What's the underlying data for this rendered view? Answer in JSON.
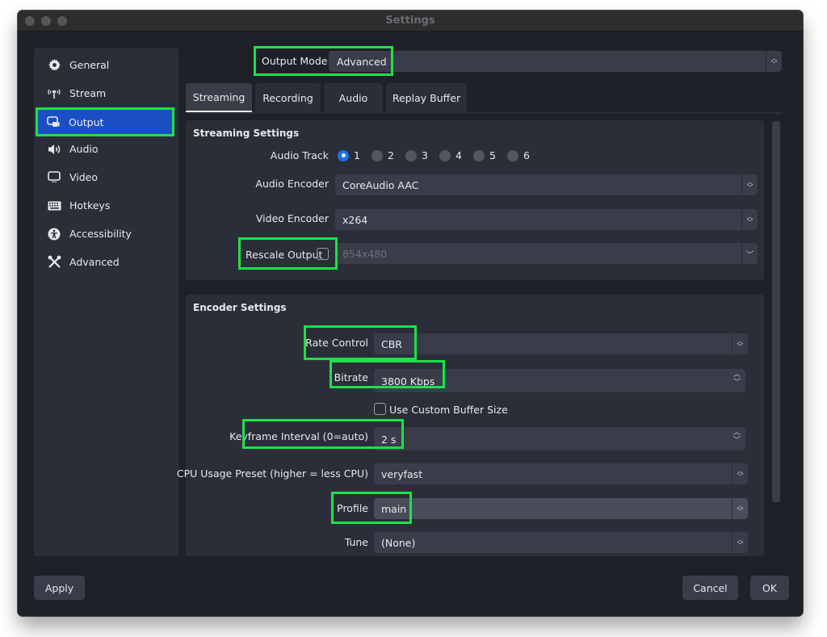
{
  "window": {
    "title": "Settings"
  },
  "sidebar": {
    "items": [
      {
        "label": "General",
        "icon": "gear-icon"
      },
      {
        "label": "Stream",
        "icon": "antenna-icon"
      },
      {
        "label": "Output",
        "icon": "output-icon",
        "active": true
      },
      {
        "label": "Audio",
        "icon": "speaker-icon"
      },
      {
        "label": "Video",
        "icon": "monitor-icon"
      },
      {
        "label": "Hotkeys",
        "icon": "keyboard-icon"
      },
      {
        "label": "Accessibility",
        "icon": "accessibility-icon"
      },
      {
        "label": "Advanced",
        "icon": "tools-icon"
      }
    ]
  },
  "output_mode": {
    "label": "Output Mode",
    "value": "Advanced"
  },
  "tabs": [
    {
      "label": "Streaming",
      "active": true
    },
    {
      "label": "Recording"
    },
    {
      "label": "Audio"
    },
    {
      "label": "Replay Buffer"
    }
  ],
  "streaming_settings": {
    "title": "Streaming Settings",
    "audio_track": {
      "label": "Audio Track",
      "options": [
        "1",
        "2",
        "3",
        "4",
        "5",
        "6"
      ],
      "selected": "1"
    },
    "audio_encoder": {
      "label": "Audio Encoder",
      "value": "CoreAudio AAC"
    },
    "video_encoder": {
      "label": "Video Encoder",
      "value": "x264"
    },
    "rescale_output": {
      "label": "Rescale Output",
      "checked": false,
      "value": "854x480"
    }
  },
  "encoder_settings": {
    "title": "Encoder Settings",
    "rate_control": {
      "label": "Rate Control",
      "value": "CBR"
    },
    "bitrate": {
      "label": "Bitrate",
      "value": "3800 Kbps"
    },
    "custom_buffer": {
      "label": "Use Custom Buffer Size",
      "checked": false
    },
    "keyframe_interval": {
      "label": "Keyframe Interval (0=auto)",
      "value": "2 s"
    },
    "cpu_preset": {
      "label": "CPU Usage Preset (higher = less CPU)",
      "value": "veryfast"
    },
    "profile": {
      "label": "Profile",
      "value": "main"
    },
    "tune": {
      "label": "Tune",
      "value": "(None)"
    }
  },
  "footer": {
    "apply": "Apply",
    "cancel": "Cancel",
    "ok": "OK"
  },
  "colors": {
    "accent": "#1b4fc4",
    "highlight": "#1ee04a",
    "radio_on": "#1a73e8"
  }
}
